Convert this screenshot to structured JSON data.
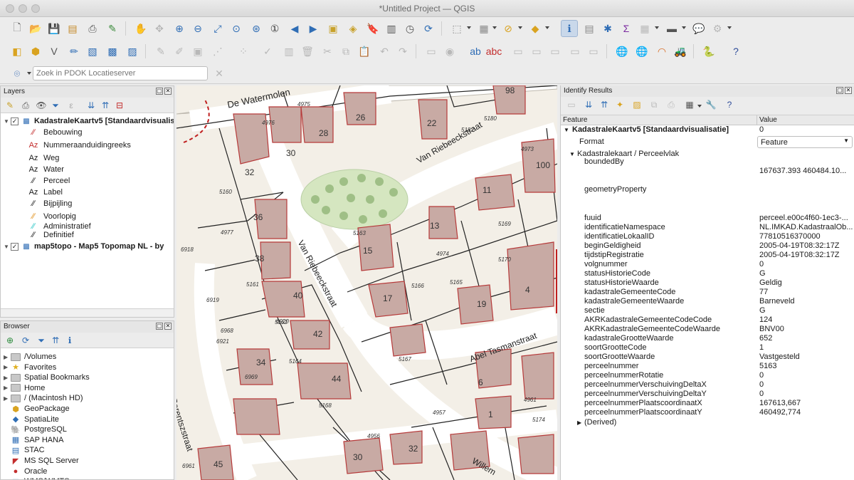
{
  "window": {
    "title": "*Untitled Project — QGIS"
  },
  "locator": {
    "placeholder": "Zoek in PDOK Locatieserver"
  },
  "layers_panel": {
    "title": "Layers",
    "items": [
      {
        "label": "KadastraleKaartv5 [Standaardvisualisatie]",
        "checked": true,
        "bold": true
      },
      {
        "label": "Bebouwing",
        "symbol": "line-red"
      },
      {
        "label": "Nummeraanduidingreeks",
        "symbol": "az-red"
      },
      {
        "label": "Weg",
        "symbol": "az"
      },
      {
        "label": "Water",
        "symbol": "az"
      },
      {
        "label": "Perceel",
        "symbol": "line-black"
      },
      {
        "label": "Label",
        "symbol": "az"
      },
      {
        "label": "Bijpijling",
        "symbol": "line-black"
      },
      {
        "label": "Voorlopig",
        "symbol": "line-orange"
      },
      {
        "label": "Administratief",
        "symbol": "line-cyan"
      },
      {
        "label": "Definitief",
        "symbol": "line-black"
      },
      {
        "label": "map5topo - Map5 Topomap NL - by",
        "checked": true,
        "bold": true
      }
    ]
  },
  "browser_panel": {
    "title": "Browser",
    "items": [
      {
        "label": "/Volumes",
        "icon": "folder-icon"
      },
      {
        "label": "Favorites",
        "icon": "star-icon"
      },
      {
        "label": "Spatial Bookmarks",
        "icon": "folder-icon"
      },
      {
        "label": "Home",
        "icon": "folder-icon"
      },
      {
        "label": "/ (Macintosh HD)",
        "icon": "folder-icon"
      },
      {
        "label": "GeoPackage",
        "icon": "geopackage-icon"
      },
      {
        "label": "SpatiaLite",
        "icon": "spatialite-icon"
      },
      {
        "label": "PostgreSQL",
        "icon": "postgresql-icon"
      },
      {
        "label": "SAP HANA",
        "icon": "sap-hana-icon"
      },
      {
        "label": "STAC",
        "icon": "stac-icon"
      },
      {
        "label": "MS SQL Server",
        "icon": "mssql-icon"
      },
      {
        "label": "Oracle",
        "icon": "oracle-icon"
      },
      {
        "label": "WMS/WMTS",
        "icon": "wms-icon"
      }
    ]
  },
  "map": {
    "streets": [
      "De Watermolen",
      "Van Riebeeckstraat",
      "Van Riebeeckstraat",
      "Abel Tasmanstraat",
      "Willem Barentszstraat",
      "Willem"
    ],
    "house_numbers": [
      "36",
      "38",
      "40",
      "42",
      "34",
      "44",
      "32",
      "30",
      "28",
      "26",
      "22",
      "13",
      "15",
      "17",
      "19",
      "4",
      "6",
      "11",
      "100",
      "98",
      "1",
      "30",
      "32",
      "45"
    ],
    "parcel_numbers": [
      "4976",
      "4975",
      "5182",
      "5180",
      "4973",
      "5163",
      "5160",
      "4977",
      "6918",
      "5161",
      "6919",
      "6920",
      "6968",
      "6921",
      "6969",
      "5162",
      "5164",
      "5166",
      "5165",
      "4974",
      "5170",
      "5169",
      "5167",
      "5168",
      "4956",
      "4957",
      "4961",
      "5174",
      "6961"
    ]
  },
  "identify": {
    "title": "Identify Results",
    "col_feature": "Feature",
    "col_value": "Value",
    "layer_row": {
      "label": "KadastraleKaartv5 [Standaardvisualisatie]",
      "value": "0"
    },
    "format_label": "Format",
    "format_value": "Feature",
    "group_label": "Kadastralekaart / Perceelvlak",
    "rows": [
      {
        "k": "boundedBy",
        "v": ""
      },
      {
        "k": "",
        "v": "167637.393 460484.10..."
      },
      {
        "k": "geometryProperty",
        "v": ""
      },
      {
        "k": "fuuid",
        "v": "perceel.e00c4f60-1ec3-..."
      },
      {
        "k": "identificatieNamespace",
        "v": "NL.IMKAD.KadastraalOb..."
      },
      {
        "k": "identificatieLokaalID",
        "v": "77810516370000"
      },
      {
        "k": "beginGeldigheid",
        "v": "2005-04-19T08:32:17Z"
      },
      {
        "k": "tijdstipRegistratie",
        "v": "2005-04-19T08:32:17Z"
      },
      {
        "k": "volgnummer",
        "v": "0"
      },
      {
        "k": "statusHistorieCode",
        "v": "G"
      },
      {
        "k": "statusHistorieWaarde",
        "v": "Geldig"
      },
      {
        "k": "kadastraleGemeenteCode",
        "v": "77"
      },
      {
        "k": "kadastraleGemeenteWaarde",
        "v": "Barneveld"
      },
      {
        "k": "sectie",
        "v": "G"
      },
      {
        "k": "AKRKadastraleGemeenteCodeCode",
        "v": "124"
      },
      {
        "k": "AKRKadastraleGemeenteCodeWaarde",
        "v": "BNV00"
      },
      {
        "k": "kadastraleGrootteWaarde",
        "v": "652"
      },
      {
        "k": "soortGrootteCode",
        "v": "1"
      },
      {
        "k": "soortGrootteWaarde",
        "v": "Vastgesteld"
      },
      {
        "k": "perceelnummer",
        "v": "5163"
      },
      {
        "k": "perceelnummerRotatie",
        "v": "0"
      },
      {
        "k": "perceelnummerVerschuivingDeltaX",
        "v": "0"
      },
      {
        "k": "perceelnummerVerschuivingDeltaY",
        "v": "0"
      },
      {
        "k": "perceelnummerPlaatscoordinaatX",
        "v": "167613,667"
      },
      {
        "k": "perceelnummerPlaatscoordinaatY",
        "v": "460492,774"
      }
    ],
    "derived_label": "(Derived)"
  }
}
